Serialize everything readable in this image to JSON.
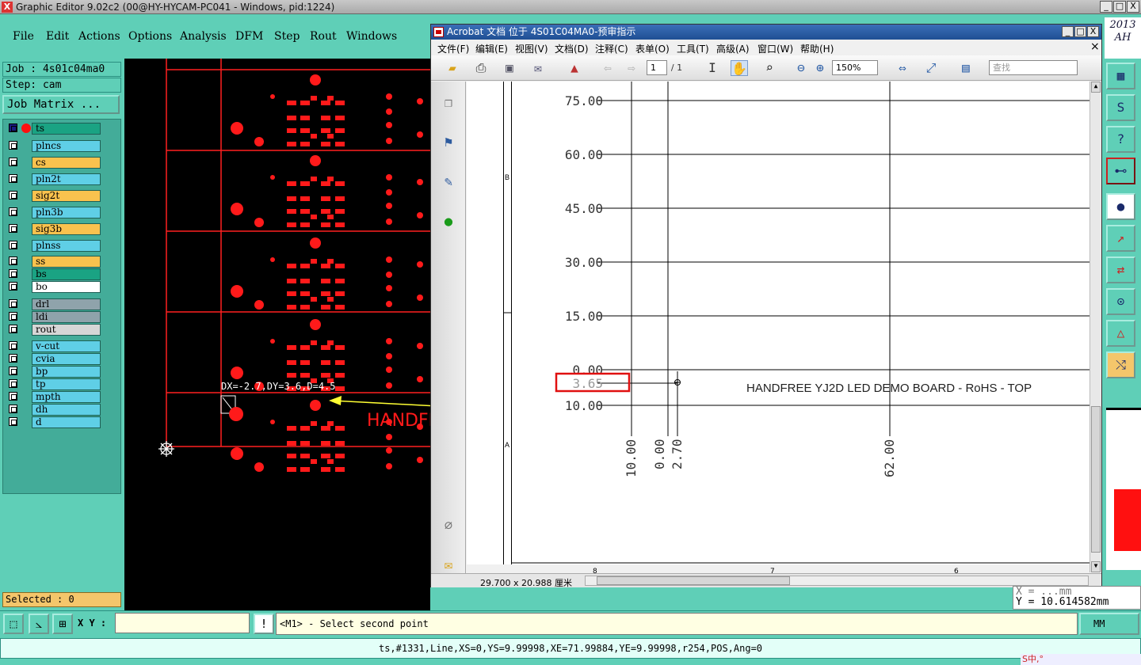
{
  "main_window": {
    "title": "Graphic Editor 9.02c2 (00@HY-HYCAM-PC041 - Windows, pid:1224)",
    "app_icon": "X",
    "minimize": "_",
    "maximize": "□",
    "close": "X",
    "date_line1": "2013",
    "date_line2": "AH"
  },
  "menubar": {
    "items": [
      "File",
      "Edit",
      "Actions",
      "Options",
      "Analysis",
      "DFM",
      "Step",
      "Rout",
      "Windows"
    ]
  },
  "left_panel": {
    "job": "Job : 4s01c04ma0",
    "step": "Step: cam",
    "job_matrix_button": "Job Matrix ...",
    "selected": "Selected : 0"
  },
  "layers": [
    {
      "name": "ts",
      "color": "#1aa383"
    },
    {
      "name": "plncs",
      "color": "#5fcfe6"
    },
    {
      "name": "cs",
      "color": "#f9c24e"
    },
    {
      "name": "pln2t",
      "color": "#5fcfe6"
    },
    {
      "name": "sig2t",
      "color": "#f9c24e"
    },
    {
      "name": "pln3b",
      "color": "#5fcfe6"
    },
    {
      "name": "sig3b",
      "color": "#f9c24e"
    },
    {
      "name": "plnss",
      "color": "#5fcfe6"
    },
    {
      "name": "ss",
      "color": "#f9c24e"
    },
    {
      "name": "bs",
      "color": "#1aa383"
    },
    {
      "name": "bo",
      "color": "#ffffff"
    },
    {
      "name": "drl",
      "color": "#8fa3ab"
    },
    {
      "name": "ldi",
      "color": "#8fa3ab"
    },
    {
      "name": "rout",
      "color": "#d6d6d6"
    },
    {
      "name": "v-cut",
      "color": "#5fcfe6"
    },
    {
      "name": "cvia",
      "color": "#5fcfe6"
    },
    {
      "name": "bp",
      "color": "#5fcfe6"
    },
    {
      "name": "tp",
      "color": "#5fcfe6"
    },
    {
      "name": "mpth",
      "color": "#5fcfe6"
    },
    {
      "name": "dh",
      "color": "#5fcfe6"
    },
    {
      "name": "d",
      "color": "#5fcfe6"
    }
  ],
  "canvas": {
    "measure_readout": "DX=-2.7,DY=3.6,D=4.5",
    "board_text": "HANDFR"
  },
  "acrobat": {
    "title": "Acrobat 文档 位于 4S01C04MA0-预审指示",
    "menus": [
      "文件(F)",
      "编辑(E)",
      "视图(V)",
      "文档(D)",
      "注释(C)",
      "表单(O)",
      "工具(T)",
      "高级(A)",
      "窗口(W)",
      "帮助(H)"
    ],
    "page_current": "1",
    "page_total": "/ 1",
    "zoom": "150%",
    "search_placeholder": "查找",
    "doc_close": "×",
    "page_size": "29.700 x 20.988 厘米",
    "y_labels": [
      "75.00",
      "60.00",
      "45.00",
      "30.00",
      "15.00",
      "0.00",
      "3.65",
      "10.00"
    ],
    "x_labels": [
      "10.00",
      "0.00",
      "2.70",
      "62.00"
    ],
    "row_marks": [
      "B",
      "A"
    ],
    "col_marks": [
      "8",
      "7",
      "6"
    ],
    "board_title": "HANDFREE YJ2D LED DEMO BOARD - RoHS - TOP"
  },
  "readout": {
    "x_partial": "X = ...mm",
    "y": "Y = 10.614582mm"
  },
  "command": {
    "xy_label": "X Y :",
    "xy_value": "",
    "prompt": "<M1> - Select second point",
    "unit": "MM"
  },
  "status": {
    "text": "ts,#1331,Line,XS=0,YS=9.99998,XE=71.99884,YE=9.99998,r254,POS,Ang=0"
  },
  "tray": {
    "text": "S中,°"
  }
}
